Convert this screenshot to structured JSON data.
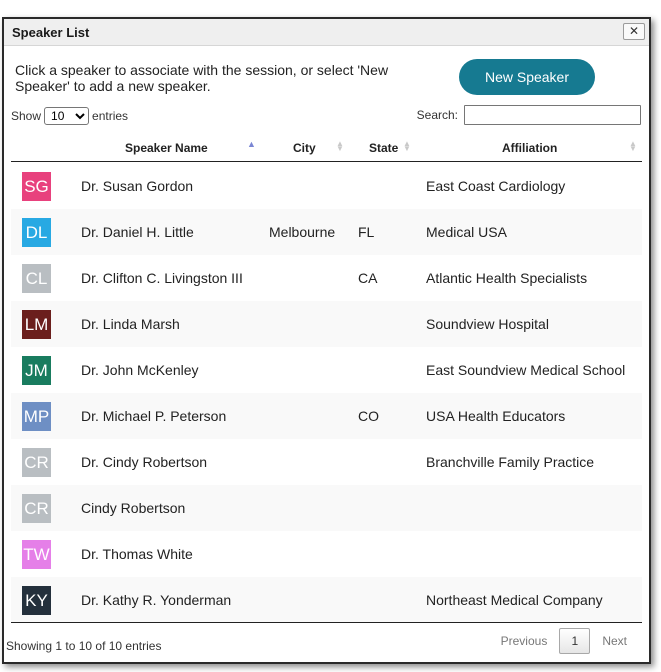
{
  "dialog": {
    "title": "Speaker List",
    "close_label": "✕",
    "intro": "Click a speaker to associate with the session, or select 'New Speaker' to add a new speaker.",
    "new_speaker_label": "New Speaker"
  },
  "controls": {
    "show_label": "Show",
    "length_value": "10",
    "entries_label": "entries",
    "search_label": "Search:",
    "search_value": ""
  },
  "table": {
    "columns": [
      {
        "label": "Speaker Name",
        "sort": "ascending"
      },
      {
        "label": "City",
        "sort": "none"
      },
      {
        "label": "State",
        "sort": "none"
      },
      {
        "label": "Affiliation",
        "sort": "none"
      }
    ],
    "rows": [
      {
        "initials": "SG",
        "color": "#e8417d",
        "name": "Dr. Susan Gordon",
        "city": "",
        "state": "",
        "affiliation": "East Coast Cardiology"
      },
      {
        "initials": "DL",
        "color": "#28a9e3",
        "name": "Dr. Daniel H. Little",
        "city": "Melbourne",
        "state": "FL",
        "affiliation": "Medical USA"
      },
      {
        "initials": "CL",
        "color": "#b9bec2",
        "name": "Dr. Clifton C. Livingston III",
        "city": "",
        "state": "CA",
        "affiliation": "Atlantic Health Specialists"
      },
      {
        "initials": "LM",
        "color": "#6b1f1d",
        "name": "Dr. Linda Marsh",
        "city": "",
        "state": "",
        "affiliation": "Soundview Hospital"
      },
      {
        "initials": "JM",
        "color": "#197c5f",
        "name": "Dr. John McKenley",
        "city": "",
        "state": "",
        "affiliation": "East Soundview Medical School"
      },
      {
        "initials": "MP",
        "color": "#6e8fc4",
        "name": "Dr. Michael P. Peterson",
        "city": "",
        "state": "CO",
        "affiliation": "USA Health Educators"
      },
      {
        "initials": "CR",
        "color": "#b9bec2",
        "name": "Dr. Cindy Robertson",
        "city": "",
        "state": "",
        "affiliation": "Branchville Family Practice"
      },
      {
        "initials": "CR",
        "color": "#b9bec2",
        "name": "Cindy Robertson",
        "city": "",
        "state": "",
        "affiliation": ""
      },
      {
        "initials": "TW",
        "color": "#e57fe8",
        "name": "Dr. Thomas White",
        "city": "",
        "state": "",
        "affiliation": ""
      },
      {
        "initials": "KY",
        "color": "#24303c",
        "name": "Dr. Kathy R. Yonderman",
        "city": "",
        "state": "",
        "affiliation": "Northeast Medical Company"
      }
    ]
  },
  "footer": {
    "info": "Showing 1 to 10 of 10 entries",
    "previous_label": "Previous",
    "current_page": "1",
    "next_label": "Next"
  }
}
